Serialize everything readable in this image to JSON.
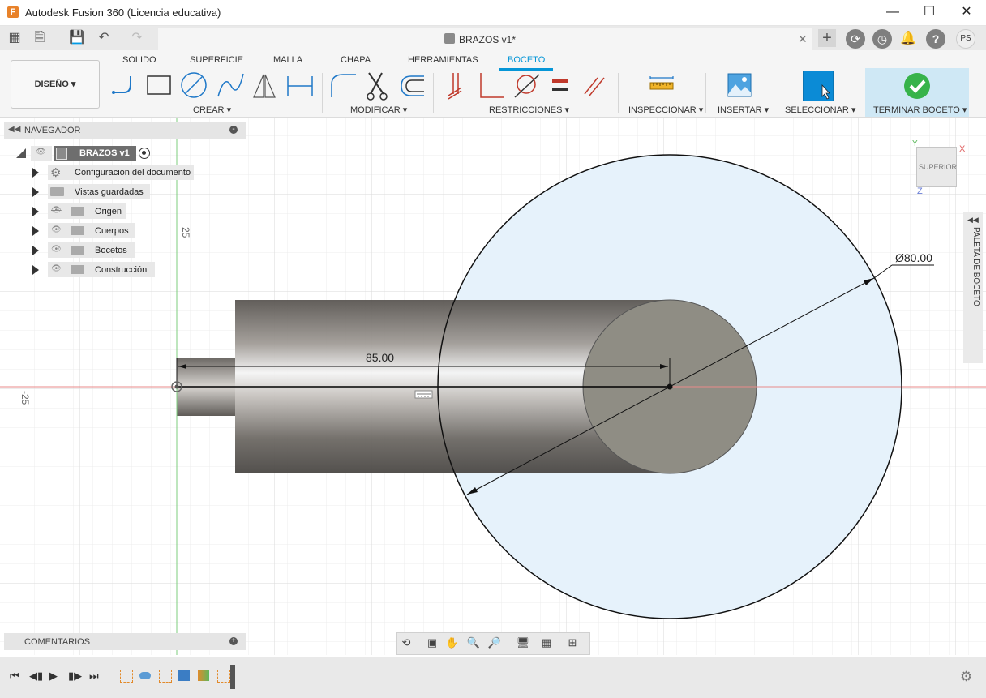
{
  "window": {
    "title": "Autodesk Fusion 360 (Licencia educativa)",
    "app_icon_letter": "F"
  },
  "document_tab": {
    "label": "BRAZOS v1*"
  },
  "user": {
    "initials": "PS"
  },
  "workspace": {
    "label": "DISEÑO"
  },
  "ribbon": {
    "tabs": [
      "SOLIDO",
      "SUPERFICIE",
      "MALLA",
      "CHAPA",
      "HERRAMIENTAS",
      "BOCETO"
    ],
    "active_tab": "BOCETO",
    "groups": {
      "crear": "CREAR",
      "modificar": "MODIFICAR",
      "restricciones": "RESTRICCIONES",
      "inspeccionar": "INSPECCIONAR",
      "insertar": "INSERTAR",
      "seleccionar": "SELECCIONAR",
      "terminar": "TERMINAR BOCETO"
    }
  },
  "navigator": {
    "title": "NAVEGADOR",
    "root": "BRAZOS v1",
    "items": [
      {
        "label": "Configuración del documento",
        "icon": "gear-icon"
      },
      {
        "label": "Vistas guardadas",
        "icon": "folder-icon"
      },
      {
        "label": "Origen",
        "icon": "folder-icon",
        "visibility": "hidden"
      },
      {
        "label": "Cuerpos",
        "icon": "folder-icon",
        "visibility": "visible"
      },
      {
        "label": "Bocetos",
        "icon": "folder-icon",
        "visibility": "visible"
      },
      {
        "label": "Construcción",
        "icon": "folder-icon",
        "visibility": "visible"
      }
    ]
  },
  "comments": {
    "label": "COMENTARIOS"
  },
  "canvas": {
    "axis_label_top": "25",
    "axis_label_left": "-25",
    "dimension_length": "85.00",
    "dimension_diameter": "Ø80.00"
  },
  "viewcube": {
    "face": "SUPERIOR",
    "axis_x": "X",
    "axis_y": "Y",
    "axis_z": "Z"
  },
  "palette": {
    "label": "PALETA DE BOCETO"
  },
  "colors": {
    "accent": "#0696d7",
    "finish": "#37b34a",
    "sketch_fill": "#e6f2fb"
  }
}
